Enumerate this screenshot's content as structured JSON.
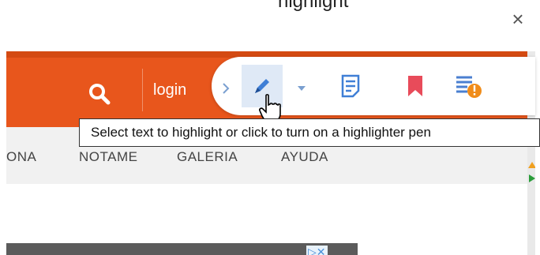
{
  "top_title_fragment": "highlight",
  "close_glyph": "×",
  "header": {
    "login_label": "login",
    "search_icon": "search-icon"
  },
  "nav": {
    "items": [
      "ONA",
      "NOTAME",
      "GALERIA",
      "AYUDA"
    ]
  },
  "toolbar": {
    "buttons": [
      {
        "name": "collapse-chevron-icon"
      },
      {
        "name": "highlighter-pen-icon"
      },
      {
        "name": "dropdown-arrow-icon"
      },
      {
        "name": "note-icon"
      },
      {
        "name": "bookmark-icon"
      },
      {
        "name": "page-alert-icon"
      }
    ]
  },
  "tooltip": {
    "text": "Select text to highlight or click to turn on a highlighter pen"
  },
  "colors": {
    "header": "#e8561c",
    "nav": "#f1f1f1",
    "accent_blue": "#4a90d9",
    "bookmark_red": "#e84b5a",
    "alert_orange": "#f08c1a"
  }
}
